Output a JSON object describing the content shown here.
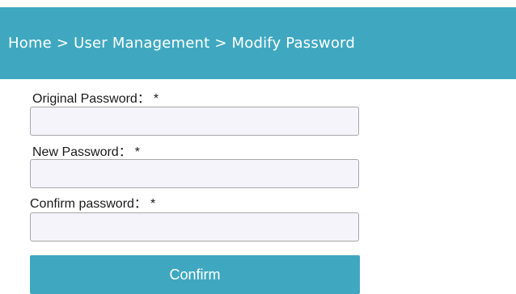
{
  "header": {
    "breadcrumb": "Home > User Management > Modify Password"
  },
  "form": {
    "original_password": {
      "label": "Original Password：",
      "required_mark": "*",
      "value": "",
      "placeholder": ""
    },
    "new_password": {
      "label": "New Password：",
      "required_mark": "*",
      "value": "",
      "placeholder": ""
    },
    "confirm_password": {
      "label": "Confirm password：",
      "required_mark": "*",
      "value": "",
      "placeholder": ""
    },
    "confirm_button_label": "Confirm"
  },
  "colors": {
    "header_bg": "#3fa8c0",
    "button_bg": "#3fa8c0",
    "input_bg": "#f4f4fa"
  }
}
